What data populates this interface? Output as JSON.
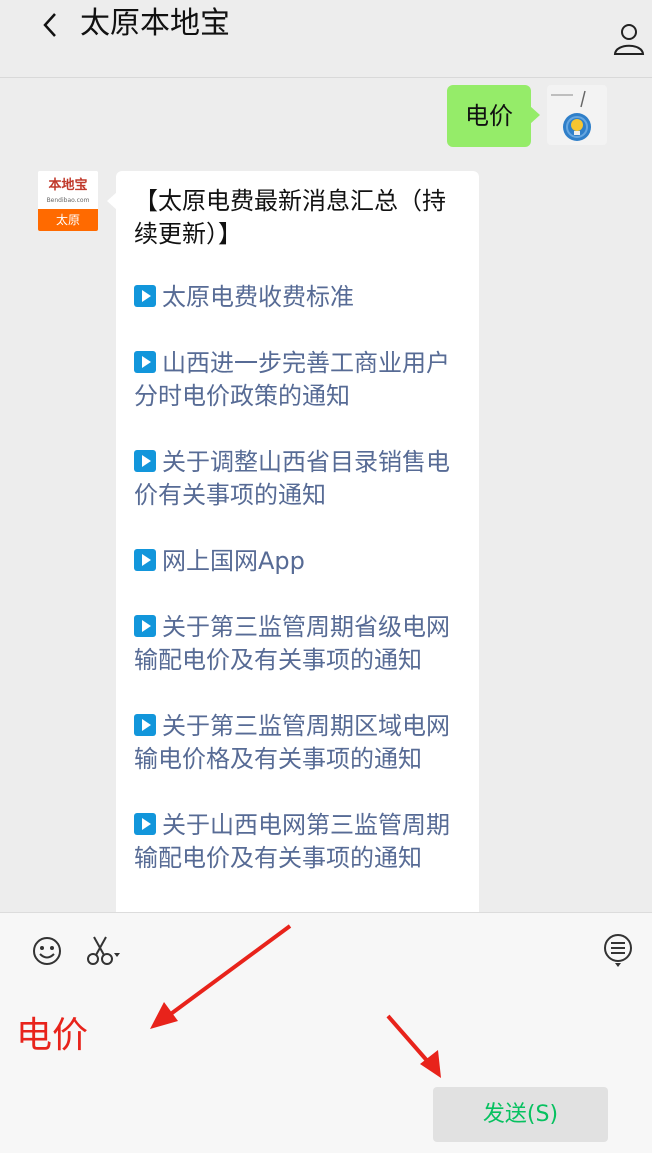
{
  "header": {
    "title": "太原本地宝"
  },
  "messages": {
    "user_text": "电价",
    "bot_avatar": {
      "brand": "本地宝",
      "domain": "Bendibao.com",
      "city": "太原"
    },
    "title": "【太原电费最新消息汇总（持续更新）】",
    "links": [
      "太原电费收费标准",
      "山西进一步完善工商业用户分时电价政策的通知",
      "关于调整山西省目录销售电价有关事项的通知",
      "网上国网App",
      "关于第三监管周期省级电网输配电价及有关事项的通知",
      "关于第三监管周期区域电网输电价格及有关事项的通知",
      "关于山西电网第三监管周期输配电价及有关事项的通知"
    ]
  },
  "input": {
    "text": "电价",
    "send_label": "发送(S)"
  },
  "colors": {
    "bubble_green": "#95ec69",
    "link_blue": "#576b95",
    "send_green": "#07c160",
    "annotation_red": "#e8231b"
  },
  "icons": [
    "back-icon",
    "profile-icon",
    "play-icon",
    "emoji-icon",
    "scissors-icon",
    "list-icon",
    "arrow-annotation"
  ]
}
